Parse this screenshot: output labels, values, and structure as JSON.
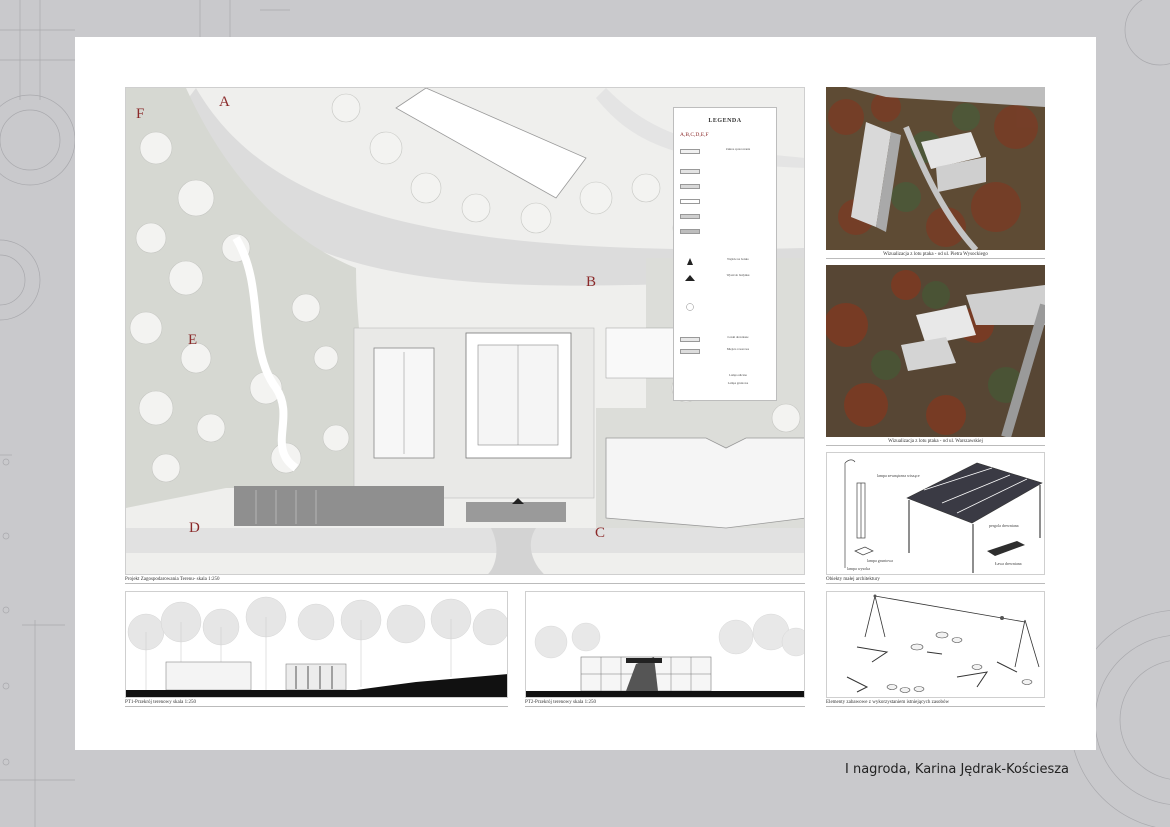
{
  "plan": {
    "letters": [
      "A",
      "B",
      "C",
      "D",
      "E",
      "F"
    ],
    "caption": "Projekt Zagospodarowania Terenu- skala 1:250"
  },
  "legend": {
    "title": "LEGENDA",
    "letters": "A,B,C,D,E,F",
    "items": [
      "Zakres opracowania",
      "Wejście na boisko",
      "Wjazd do budynku",
      "Ławki drewniane",
      "Miejsca rowerowe",
      "Lampa uliczna",
      "Lampa gruntowa"
    ]
  },
  "renders": {
    "top_caption": "Wizualizacja z lotu ptaka - od ul. Pietra Wysockiego",
    "bottom_caption": "Wizualizacja z lotu ptaka - od ul. Warszawskiej"
  },
  "objects": {
    "caption": "Obiekty małej architektury",
    "labels": {
      "lamp_recessed": "lampa zewnętrzna wiszące",
      "lamp_ground": "lampa gruntowa",
      "lamp_street": "lampa wysoka",
      "pergola": "pergola drewniana",
      "bench": "Ława drewniana"
    }
  },
  "play": {
    "caption": "Elementy zabawowe z wykorzystaniem istniejących zasobów"
  },
  "sections": {
    "pt1_caption": "PT1-Przekrój terenowy skala 1:250",
    "pt2_caption": "PT2-Przekrój terenowy skala 1:250"
  },
  "credit": "I nagroda, Karina Jędrak-Kościesza",
  "colors": {
    "background": "#c9c9cc",
    "board": "#ffffff",
    "accent_letters": "#8b2a2a",
    "greenery": "#d6d8d2",
    "ground_dark": "#111111"
  }
}
